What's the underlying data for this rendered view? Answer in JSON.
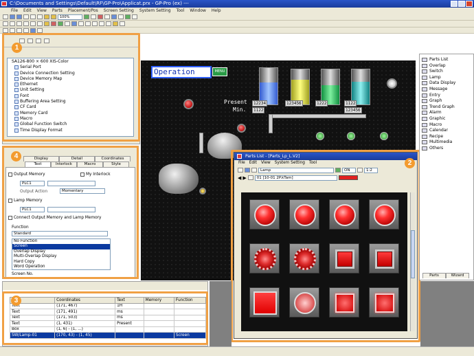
{
  "titlebar": {
    "title": "C:\\Documents and Settings\\Default\\RF\\GP-Pro\\Applicat.prx - GP-Pro (ex) ---"
  },
  "menubar": {
    "items": [
      "File",
      "Edit",
      "View",
      "Parts",
      "Placement/Pos",
      "Screen Setting",
      "System Setting",
      "Tool",
      "Window",
      "Help"
    ]
  },
  "toolbar": {
    "zoom_value": "100%"
  },
  "callouts": {
    "one": "1",
    "two": "2",
    "three": "3",
    "four": "4"
  },
  "project_tree": {
    "root": "SA126-800 × 600 XIS-Color",
    "items": [
      "Serial Port",
      "Device Connection Setting",
      "Device Memory Map",
      "Ethernet",
      "Unit Setting",
      "Font",
      "Buffering Area Setting",
      "CF Card",
      "Memory Card",
      "Macro",
      "Global Function Switch",
      "Time Display Format"
    ]
  },
  "canvas": {
    "operation_label": "Operation",
    "menu_button": "MENU",
    "present_label": "Present",
    "min_label": "Min.",
    "digital_values": [
      "12234",
      "1122",
      "123456",
      "1222",
      "1122",
      "123456"
    ]
  },
  "properties": {
    "tabs_row1": [
      "Display",
      "Detail",
      "Coordinates"
    ],
    "tabs_row2": [
      "Text",
      "Interlock",
      "Macro",
      "Style"
    ],
    "output_memory_label": "Output Memory",
    "my_interlock_label": "My Interlock",
    "output_device": "PLC1",
    "output_action_label": "Output Action",
    "output_action_value": "Momentary",
    "lamp_memory_label": "Lamp Memory",
    "lamp_device": "PLC1",
    "connect_label": "Connect Output Memory and Lamp Memory",
    "function_label": "Function",
    "function_value": "Standard",
    "function_options": [
      "No Function",
      "Screen",
      "Overlap Display",
      "Multi-Overlap Display",
      "Hard Copy",
      "Word Operation"
    ],
    "screen_no_label": "Screen No."
  },
  "bottom_grid": {
    "columns": [
      "",
      "Coordinates",
      "Text",
      "Memory",
      "Function"
    ],
    "rows": [
      [
        "Text",
        "(171, 467)",
        "1H",
        "",
        ""
      ],
      [
        "Text",
        "(171, 491)",
        "ms",
        "",
        ""
      ],
      [
        "Text",
        "(171, 503)",
        "ms",
        "",
        ""
      ],
      [
        "Text",
        "(1, 431)",
        "Present",
        "",
        ""
      ],
      [
        "Box",
        "(1, 6) - (1, ...)",
        "",
        "",
        ""
      ],
      [
        "SW/Lamp-01",
        "(170, 43) - (1, 45)",
        "",
        "",
        "Screen"
      ]
    ]
  },
  "parts_window": {
    "title": "Parts List - [Parts_Lp_L.V2]",
    "menu": [
      "File",
      "Edit",
      "View",
      "System Setting",
      "Tool"
    ],
    "category": "Lamp",
    "state": "ON",
    "zoom": "1:2",
    "part_name": "01 [10-01 2P.kTam]",
    "rows": [
      [
        "circle",
        "circle",
        "circle",
        "circle"
      ],
      [
        "dotted",
        "dotted",
        "square",
        "square"
      ],
      [
        "square-light",
        "glow",
        "square-glow",
        "square-glow"
      ]
    ]
  },
  "parts_list": {
    "items": [
      "Parts List",
      "Overlap",
      "Switch",
      "Lamp",
      "Data Display",
      "Message",
      "Entry",
      "Graph",
      "Trend Graph",
      "Alarm",
      "Graphic",
      "Macro",
      "Calendar",
      "Recipe",
      "Multimedia",
      "Others"
    ],
    "tabs": [
      "Parts",
      "Wizard"
    ]
  }
}
